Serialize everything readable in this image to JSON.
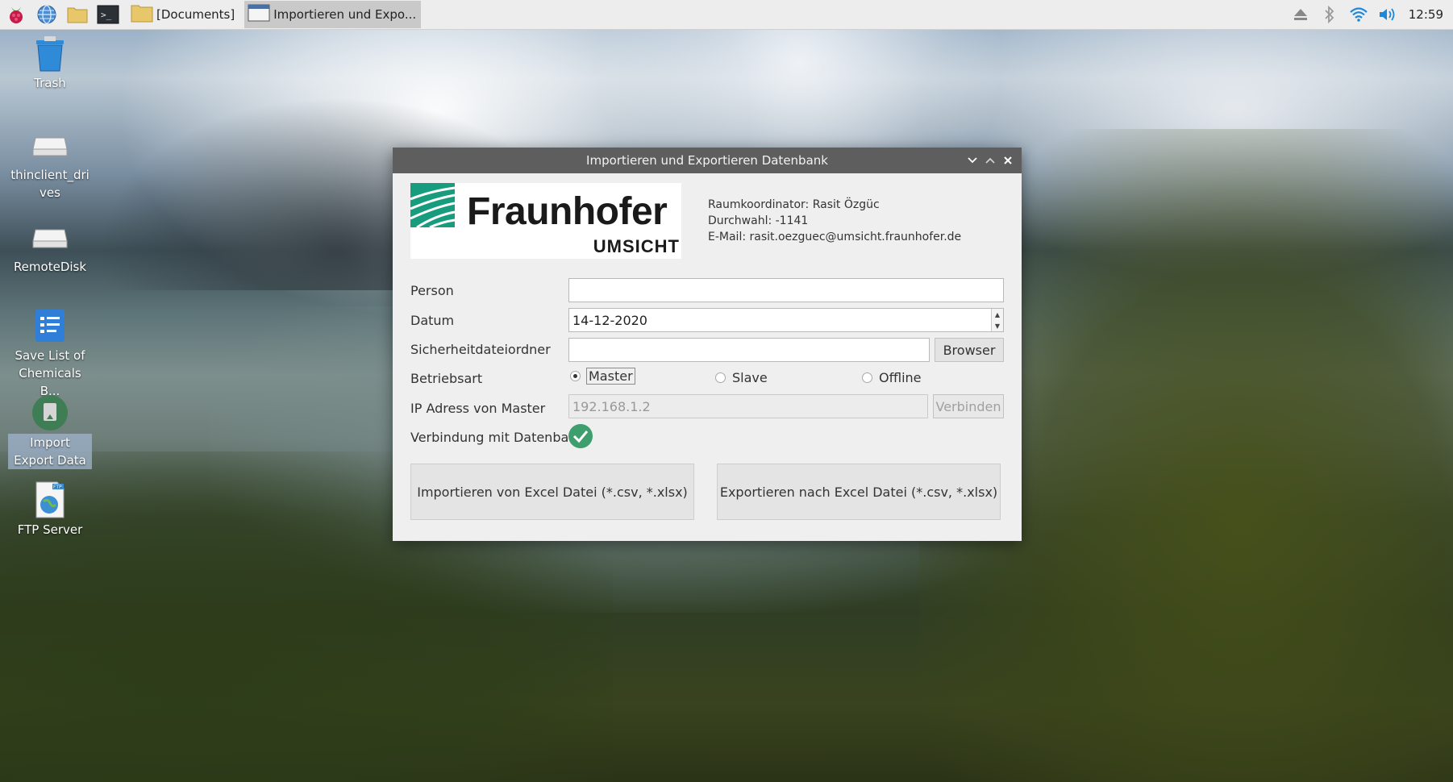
{
  "taskbar": {
    "documents_task": "[Documents]",
    "active_task": "Importieren und Expo...",
    "clock": "12:59"
  },
  "desktop": {
    "icons": [
      {
        "label": "Trash"
      },
      {
        "label": "thinclient_drives"
      },
      {
        "label": "RemoteDisk"
      },
      {
        "label": "Save List of Chemicals B..."
      },
      {
        "label": "Import Export Data"
      },
      {
        "label": "FTP Server"
      }
    ]
  },
  "dialog": {
    "title": "Importieren und Exportieren Datenbank",
    "logo_text": "Fraunhofer",
    "logo_subtext": "UMSICHT",
    "contact": {
      "coordinator": "Raumkoordinator: Rasit Özgüc",
      "phone": "Durchwahl: -1141",
      "email": "E-Mail: rasit.oezguec@umsicht.fraunhofer.de"
    },
    "labels": {
      "person": "Person",
      "datum": "Datum",
      "backup_folder": "Sicherheitdateiordner",
      "mode": "Betriebsart",
      "ip": "IP Adress von Master",
      "connection": "Verbindung mit Datenbank"
    },
    "values": {
      "person": "",
      "datum": "14-12-2020",
      "backup_folder": "",
      "ip_placeholder": "192.168.1.2"
    },
    "buttons": {
      "browse": "Browser",
      "connect": "Verbinden",
      "import": "Importieren von Excel Datei (*.csv, *.xlsx)",
      "export": "Exportieren nach Excel Datei (*.csv, *.xlsx)"
    },
    "modes": [
      "Master",
      "Slave",
      "Offline"
    ],
    "selected_mode": "Master",
    "connection_status": "connected",
    "colors": {
      "titlebar": "#5e5e5e",
      "check": "#3f9e6e",
      "logo_green": "#179c7d"
    }
  }
}
